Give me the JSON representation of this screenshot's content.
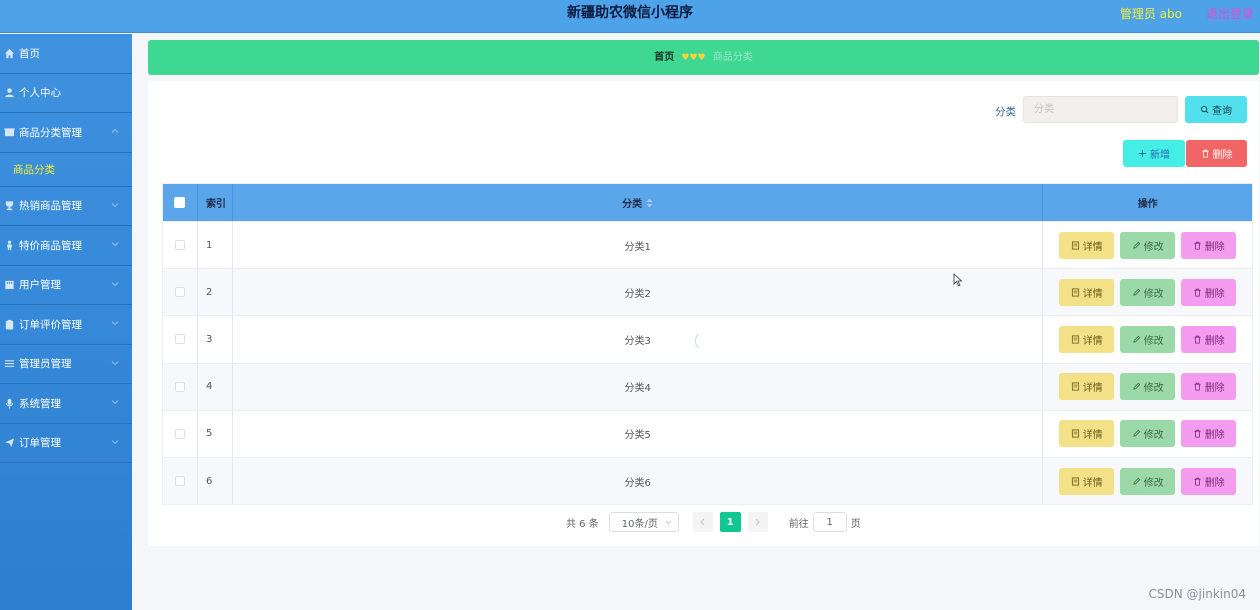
{
  "header": {
    "title": "新疆助农微信小程序",
    "admin_label": "管理员 abo",
    "logout_label": "退出登录"
  },
  "sidebar": {
    "items": [
      {
        "label": "首页",
        "icon": "home-icon"
      },
      {
        "label": "个人中心",
        "icon": "user-icon"
      },
      {
        "label": "商品分类管理",
        "icon": "box-icon",
        "expanded": true,
        "children": [
          {
            "label": "商品分类"
          }
        ]
      },
      {
        "label": "热销商品管理",
        "icon": "trophy-icon"
      },
      {
        "label": "特价商品管理",
        "icon": "person-icon"
      },
      {
        "label": "用户管理",
        "icon": "building-icon"
      },
      {
        "label": "订单评价管理",
        "icon": "clipboard-icon"
      },
      {
        "label": "管理员管理",
        "icon": "sliders-icon"
      },
      {
        "label": "系统管理",
        "icon": "mic-icon"
      },
      {
        "label": "订单管理",
        "icon": "send-icon"
      }
    ]
  },
  "breadcrumb": {
    "home": "首页",
    "separator": "♥♥♥",
    "current": "商品分类"
  },
  "search": {
    "label": "分类",
    "placeholder": "分类",
    "query_label": "查询"
  },
  "actions": {
    "add_label": "新增",
    "delete_label": "删除"
  },
  "table": {
    "headers": {
      "index": "索引",
      "category": "分类",
      "ops": "操作"
    },
    "rows": [
      {
        "index": "1",
        "category": "分类1"
      },
      {
        "index": "2",
        "category": "分类2"
      },
      {
        "index": "3",
        "category": "分类3"
      },
      {
        "index": "4",
        "category": "分类4"
      },
      {
        "index": "5",
        "category": "分类5"
      },
      {
        "index": "6",
        "category": "分类6"
      }
    ],
    "op_labels": {
      "detail": "详情",
      "edit": "修改",
      "delete": "删除"
    }
  },
  "pagination": {
    "total": "共 6 条",
    "page_size": "10条/页",
    "current_page": "1",
    "goto_label": "前往",
    "goto_value": "1",
    "page_suffix": "页"
  },
  "watermark": "CSDN @jinkin04",
  "colors": {
    "header": "#4ea2e8",
    "sidebar": "#3588d8",
    "breadcrumb": "#3fd893",
    "table_header": "#5ba6ea",
    "detail": "#f2e186",
    "edit": "#9cd9a8",
    "delete": "#f49cf0",
    "active_page": "#0fc790"
  }
}
